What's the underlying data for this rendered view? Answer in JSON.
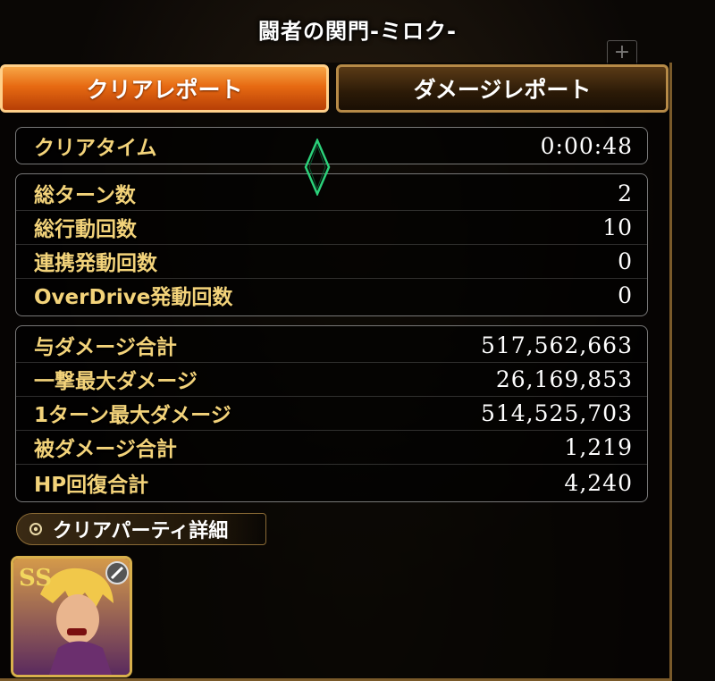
{
  "header": {
    "title": "闘者の関門-ミロク-"
  },
  "tabs": [
    {
      "label": "クリアレポート",
      "active": true
    },
    {
      "label": "ダメージレポート",
      "active": false
    }
  ],
  "report": {
    "clear_time": {
      "label": "クリアタイム",
      "value": "0:00:48"
    },
    "counts": [
      {
        "label": "総ターン数",
        "value": "2"
      },
      {
        "label": "総行動回数",
        "value": "10"
      },
      {
        "label": "連携発動回数",
        "value": "0"
      },
      {
        "label": "OverDrive発動回数",
        "value": "0"
      }
    ],
    "damage": [
      {
        "label": "与ダメージ合計",
        "value": "517,562,663"
      },
      {
        "label": "一撃最大ダメージ",
        "value": "26,169,853"
      },
      {
        "label": "1ターン最大ダメージ",
        "value": "514,525,703"
      },
      {
        "label": "被ダメージ合計",
        "value": "1,219"
      },
      {
        "label": "HP回復合計",
        "value": "4,240"
      }
    ]
  },
  "party": {
    "label": "クリアパーティ詳細"
  },
  "colors": {
    "label_gold": "#f3d37a",
    "tab_active": "#e76a12",
    "frame": "#7a5a2a"
  }
}
